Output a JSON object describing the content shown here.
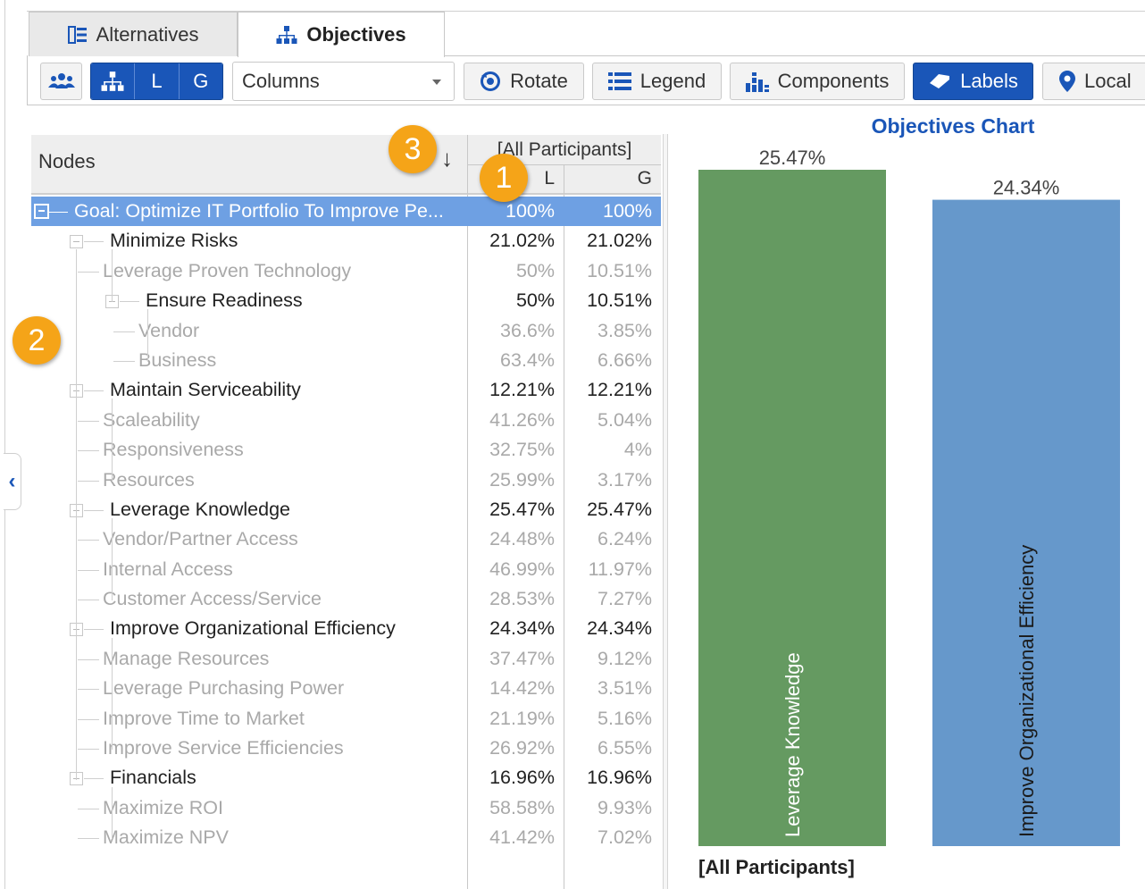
{
  "tabs": [
    {
      "label": "Alternatives",
      "icon": "list-icon"
    },
    {
      "label": "Objectives",
      "icon": "hierarchy-icon",
      "active": true
    }
  ],
  "toolbar": {
    "participants_icon": "users-icon",
    "hierarchy_icon": "hierarchy-icon",
    "seg_L": "L",
    "seg_G": "G",
    "select_value": "Columns",
    "rotate_label": "Rotate",
    "legend_label": "Legend",
    "components_label": "Components",
    "labels_label": "Labels",
    "local_label": "Local"
  },
  "grid": {
    "nodes_header": "Nodes",
    "group_header": "[All Participants]",
    "col_L": "L",
    "col_G": "G",
    "rows": [
      {
        "label": "Goal: Optimize IT Portfolio To Improve Pe...",
        "L": "100%",
        "G": "100%",
        "level": 0
      },
      {
        "label": "Minimize Risks",
        "L": "21.02%",
        "G": "21.02%",
        "level": 1
      },
      {
        "label": "Leverage Proven Technology",
        "L": "50%",
        "G": "10.51%",
        "level": 2,
        "leaf": true
      },
      {
        "label": "Ensure Readiness",
        "L": "50%",
        "G": "10.51%",
        "level": 2
      },
      {
        "label": "Vendor",
        "L": "36.6%",
        "G": "3.85%",
        "level": 3,
        "leaf": true
      },
      {
        "label": "Business",
        "L": "63.4%",
        "G": "6.66%",
        "level": 3,
        "leaf": true
      },
      {
        "label": "Maintain Serviceability",
        "L": "12.21%",
        "G": "12.21%",
        "level": 1
      },
      {
        "label": "Scaleability",
        "L": "41.26%",
        "G": "5.04%",
        "level": 2,
        "leaf": true
      },
      {
        "label": "Responsiveness",
        "L": "32.75%",
        "G": "4%",
        "level": 2,
        "leaf": true
      },
      {
        "label": "Resources",
        "L": "25.99%",
        "G": "3.17%",
        "level": 2,
        "leaf": true
      },
      {
        "label": "Leverage Knowledge",
        "L": "25.47%",
        "G": "25.47%",
        "level": 1
      },
      {
        "label": "Vendor/Partner Access",
        "L": "24.48%",
        "G": "6.24%",
        "level": 2,
        "leaf": true
      },
      {
        "label": "Internal Access",
        "L": "46.99%",
        "G": "11.97%",
        "level": 2,
        "leaf": true
      },
      {
        "label": "Customer Access/Service",
        "L": "28.53%",
        "G": "7.27%",
        "level": 2,
        "leaf": true
      },
      {
        "label": "Improve Organizational Efficiency",
        "L": "24.34%",
        "G": "24.34%",
        "level": 1
      },
      {
        "label": "Manage Resources",
        "L": "37.47%",
        "G": "9.12%",
        "level": 2,
        "leaf": true
      },
      {
        "label": "Leverage Purchasing Power",
        "L": "14.42%",
        "G": "3.51%",
        "level": 2,
        "leaf": true
      },
      {
        "label": "Improve Time to Market",
        "L": "21.19%",
        "G": "5.16%",
        "level": 2,
        "leaf": true
      },
      {
        "label": "Improve Service Efficiencies",
        "L": "26.92%",
        "G": "6.55%",
        "level": 2,
        "leaf": true
      },
      {
        "label": "Financials",
        "L": "16.96%",
        "G": "16.96%",
        "level": 1
      },
      {
        "label": "Maximize ROI",
        "L": "58.58%",
        "G": "9.93%",
        "level": 2,
        "leaf": true
      },
      {
        "label": "Maximize NPV",
        "L": "41.42%",
        "G": "7.02%",
        "level": 2,
        "leaf": true
      }
    ]
  },
  "callouts": [
    "1",
    "2",
    "3"
  ],
  "sort_icon": "↓",
  "side_toggle_icon": "‹",
  "chart_data": {
    "type": "bar",
    "title": "Objectives Chart",
    "xlabel": "[All Participants]",
    "categories": [
      "Leverage Knowledge",
      "Improve Organizational Efficiency"
    ],
    "values": [
      25.47,
      24.34
    ],
    "value_labels": [
      "25.47%",
      "24.34%"
    ],
    "colors": [
      "#659a61",
      "#6698cb"
    ],
    "ylim": [
      0,
      25.47
    ],
    "grid": false,
    "legend": false
  }
}
